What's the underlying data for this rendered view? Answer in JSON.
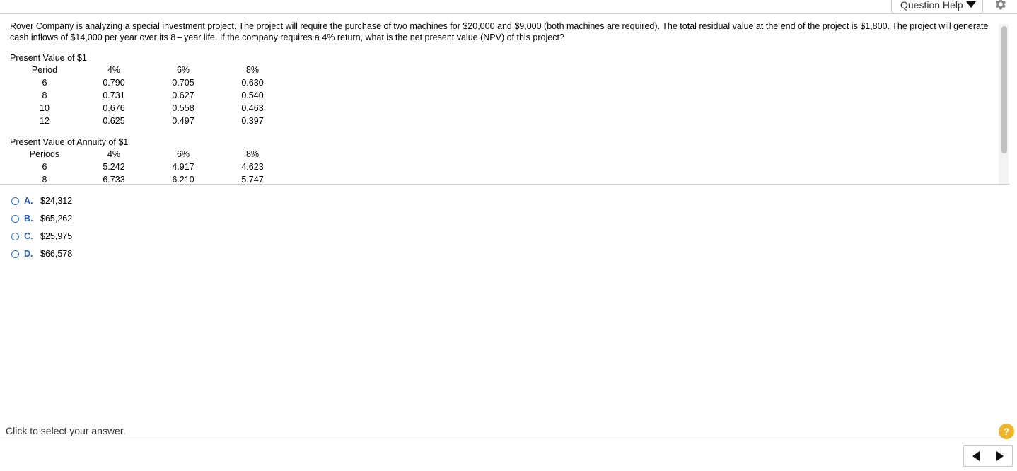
{
  "header": {
    "question_help_label": "Question Help",
    "help_menu_icon": "triangle-down-icon",
    "settings_icon": "gear-icon"
  },
  "question": {
    "text": "Rover Company is analyzing a special investment project. The project will require the purchase of two machines for $20,000 and $9,000 (both machines are required). The total residual value at the end of the project is $1,800. The project will generate cash inflows of $14,000 per year over its 8 – year life. If the company requires a 4% return, what is the net present value (NPV) of this project?"
  },
  "pv_table": {
    "title": "Present Value of $1",
    "headers": [
      "Period",
      "4%",
      "6%",
      "8%"
    ],
    "rows": [
      [
        "6",
        "0.790",
        "0.705",
        "0.630"
      ],
      [
        "8",
        "0.731",
        "0.627",
        "0.540"
      ],
      [
        "10",
        "0.676",
        "0.558",
        "0.463"
      ],
      [
        "12",
        "0.625",
        "0.497",
        "0.397"
      ]
    ]
  },
  "pva_table": {
    "title": "Present Value of Annuity of $1",
    "headers": [
      "Periods",
      "4%",
      "6%",
      "8%"
    ],
    "rows": [
      [
        "6",
        "5.242",
        "4.917",
        "4.623"
      ],
      [
        "8",
        "6.733",
        "6.210",
        "5.747"
      ]
    ]
  },
  "options": [
    {
      "letter": "A.",
      "text": "$24,312"
    },
    {
      "letter": "B.",
      "text": "$65,262"
    },
    {
      "letter": "C.",
      "text": "$25,975"
    },
    {
      "letter": "D.",
      "text": "$66,578"
    }
  ],
  "footer": {
    "instruction": "Click to select your answer.",
    "help_icon_label": "?",
    "help_icon": "help-circle-icon",
    "prev_icon": "triangle-left-icon",
    "next_icon": "triangle-right-icon"
  },
  "colors": {
    "accent": "#1f5bb8",
    "radio": "#2f6fd4",
    "help": "#f0b429"
  }
}
